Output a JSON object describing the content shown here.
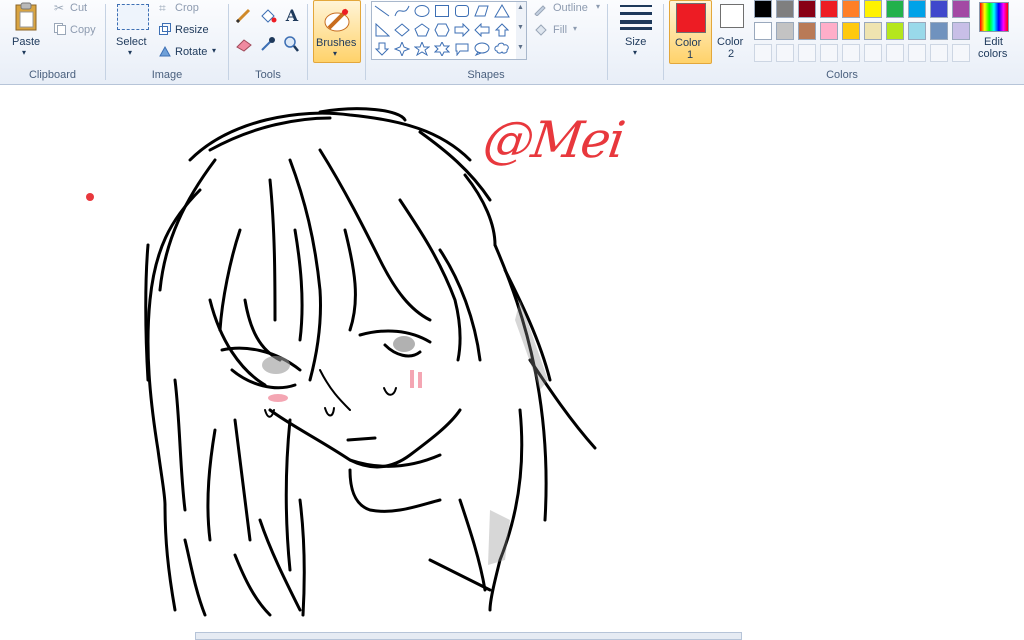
{
  "clipboard": {
    "paste_label": "Paste",
    "cut_label": "Cut",
    "copy_label": "Copy",
    "group_label": "Clipboard"
  },
  "image": {
    "select_label": "Select",
    "crop_label": "Crop",
    "resize_label": "Resize",
    "rotate_label": "Rotate",
    "group_label": "Image"
  },
  "tools": {
    "group_label": "Tools"
  },
  "brushes": {
    "label": "Brushes"
  },
  "shapes": {
    "outline_label": "Outline",
    "fill_label": "Fill",
    "group_label": "Shapes"
  },
  "size": {
    "label": "Size"
  },
  "colors": {
    "color1_label": "Color",
    "color1_num": "1",
    "color2_label": "Color",
    "color2_num": "2",
    "edit_label_1": "Edit",
    "edit_label_2": "colors",
    "group_label": "Colors",
    "color1_value": "#ed1c24",
    "color2_value": "#ffffff",
    "palette_row1": [
      "#000000",
      "#7f7f7f",
      "#880015",
      "#ed1c24",
      "#ff7f27",
      "#fff200",
      "#22b14c",
      "#00a2e8",
      "#3f48cc",
      "#a349a4"
    ],
    "palette_row2": [
      "#ffffff",
      "#c3c3c3",
      "#b97a57",
      "#ffaec9",
      "#ffc90e",
      "#efe4b0",
      "#b5e61d",
      "#99d9ea",
      "#7092be",
      "#c8bfe7"
    ]
  },
  "canvas": {
    "signature_text": "@Mei",
    "signature_color": "#e8383d",
    "blush_color": "#f4a6b3"
  }
}
